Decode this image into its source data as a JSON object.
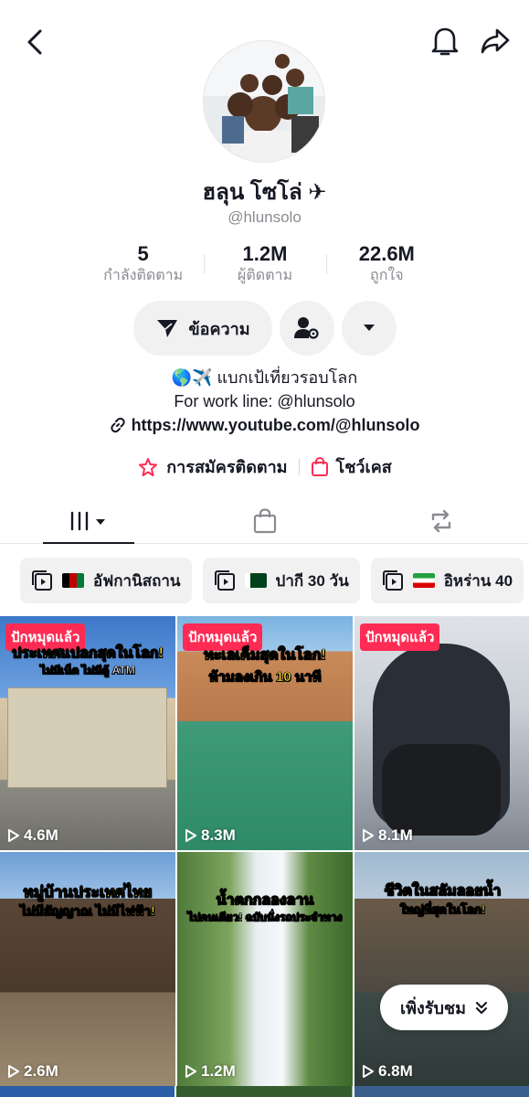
{
  "profile": {
    "name": "ฮลุน โซโล่ ✈",
    "handle": "@hlunsolo"
  },
  "stats": [
    {
      "value": "5",
      "label": "กำลังติดตาม"
    },
    {
      "value": "1.2M",
      "label": "ผู้ติดตาม"
    },
    {
      "value": "22.6M",
      "label": "ถูกใจ"
    }
  ],
  "actions": {
    "message_label": "ข้อความ"
  },
  "bio": {
    "line1": "🌎✈️ แบกเป้เที่ยวรอบโลก",
    "line2": "For work line: @hlunsolo",
    "link": "https://www.youtube.com/@hlunsolo"
  },
  "links": {
    "subscribe": "การสมัครติดตาม",
    "showcase": "โชว์เคส"
  },
  "playlists": [
    {
      "label": "อัฟกานิสถาน"
    },
    {
      "label": "ปากี 30 วัน"
    },
    {
      "label": "อิหร่าน 40"
    }
  ],
  "videos": [
    {
      "badge": "ปักหมุดแล้ว",
      "caption": "ประเทศแปลกสุดในโลก!",
      "caption2": "ไม่มีเน็ต ไม่มีตู้ ATM",
      "views": "4.6M"
    },
    {
      "badge": "ปักหมุดแล้ว",
      "caption": "ทะเลเค็มสุดในโลก!",
      "caption2": "ห้ามลงเกิน 10 นาที",
      "views": "8.3M"
    },
    {
      "badge": "ปักหมุดแล้ว",
      "caption": "",
      "caption2": "",
      "views": "8.1M"
    },
    {
      "badge": "",
      "caption": "หมู่บ้านประเทศไทย",
      "caption2": "ไม่มีสัญญาณ ไม่มีไฟฟ้า!",
      "views": "2.6M"
    },
    {
      "badge": "",
      "caption": "น้ำตกกลองลาน",
      "caption2": "ไปคนเดียว! ฉบับนั่งรถประจำทาง",
      "views": "1.2M"
    },
    {
      "badge": "",
      "caption": "ชีวิตในสลัมลอยน้ำ",
      "caption2": "ใหญ่ที่สุดในโลก!",
      "views": "6.8M"
    }
  ],
  "watch_button": "เพิ่งรับชม",
  "colors": {
    "accent": "#fe2c55",
    "text": "#161823",
    "muted": "#8a8b91",
    "pill": "#f1f1f2"
  }
}
